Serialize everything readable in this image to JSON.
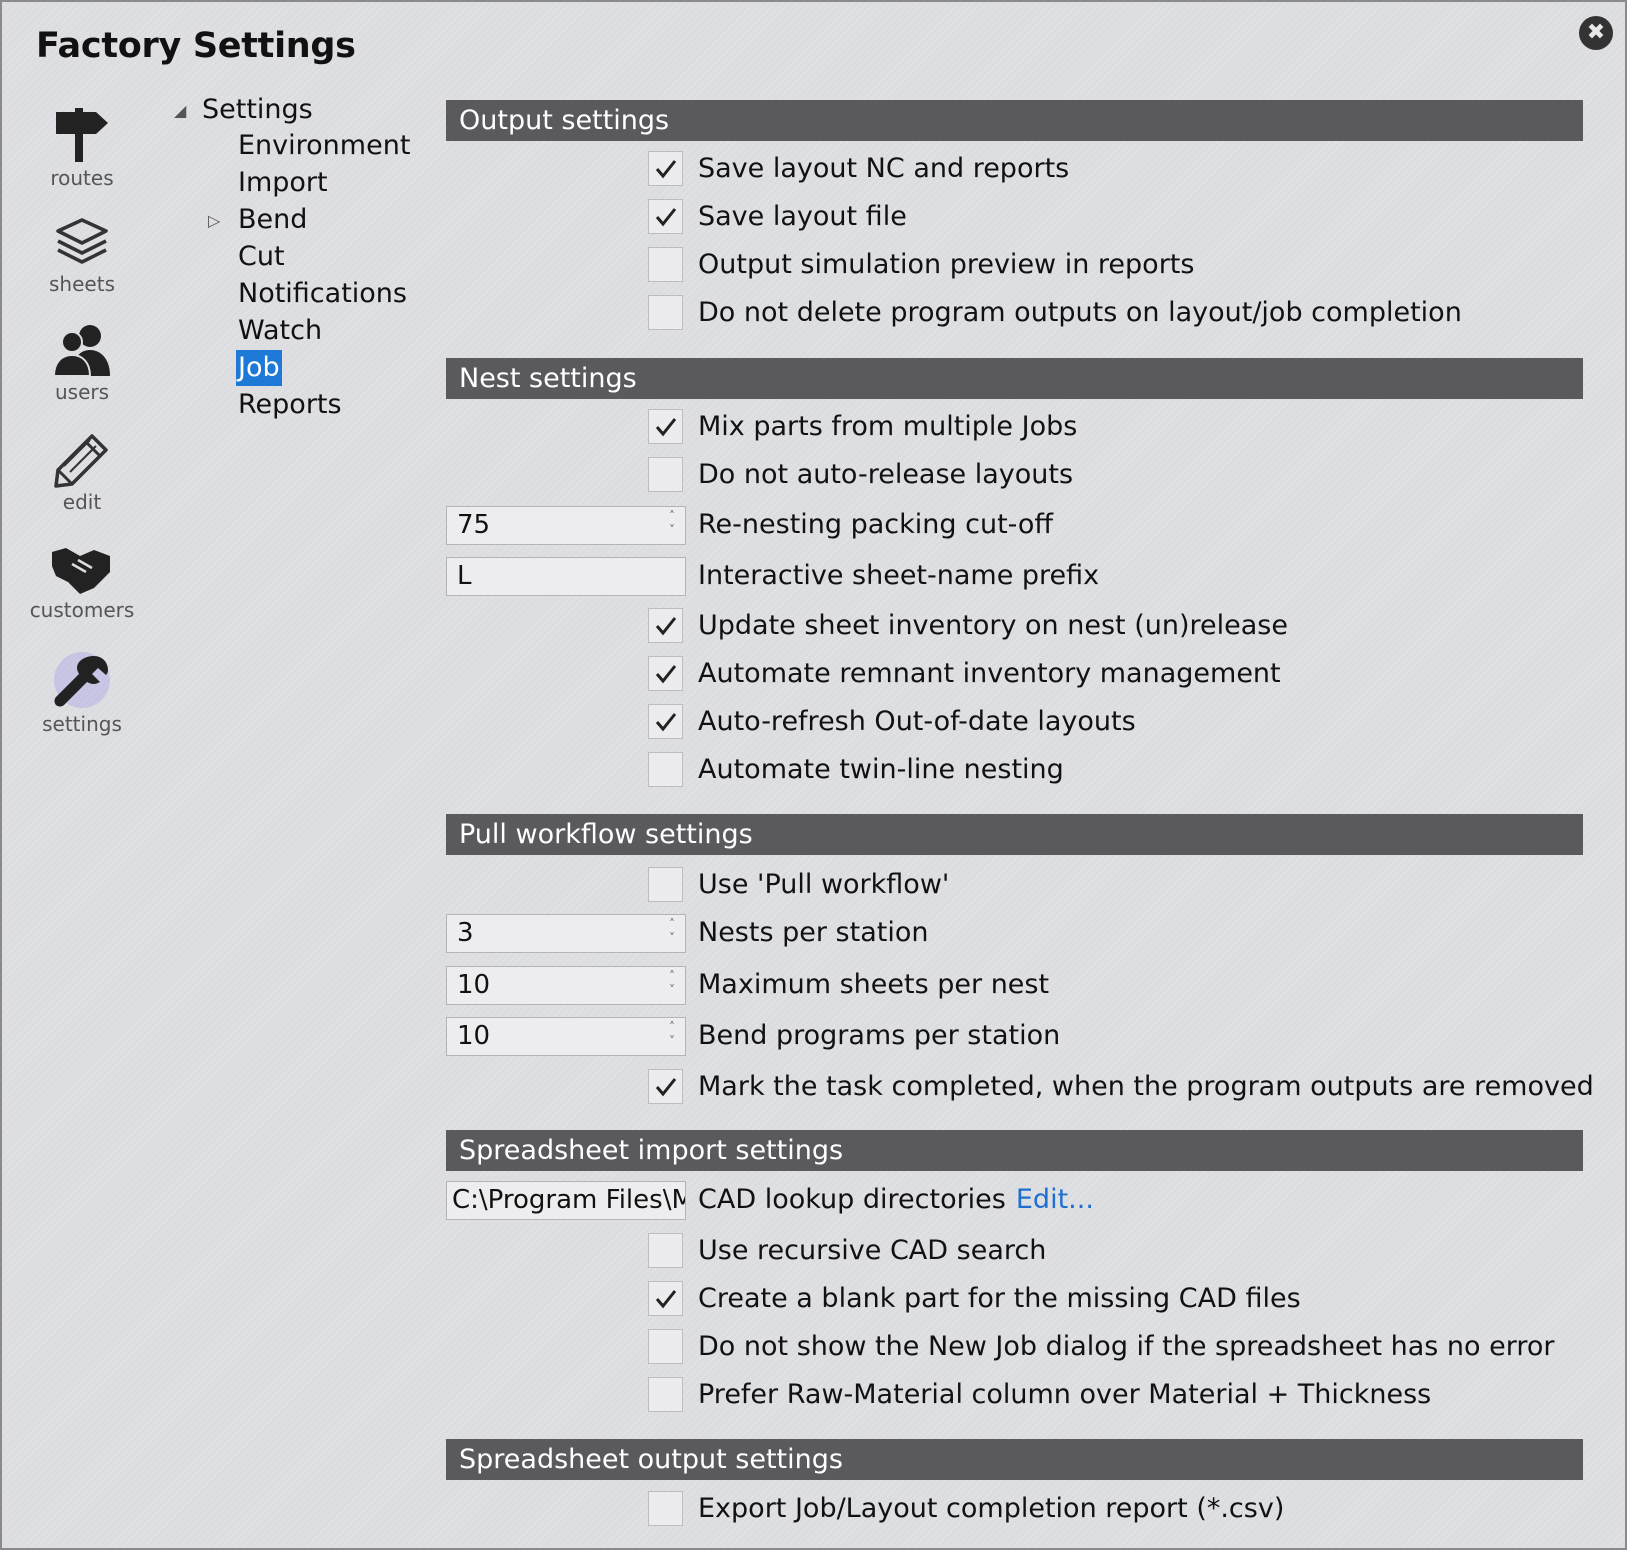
{
  "window": {
    "title": "Factory Settings",
    "close_glyph": "✖"
  },
  "rail": [
    {
      "label": "routes",
      "icon": "signpost-icon"
    },
    {
      "label": "sheets",
      "icon": "layers-icon"
    },
    {
      "label": "users",
      "icon": "users-icon"
    },
    {
      "label": "edit",
      "icon": "pencil-icon"
    },
    {
      "label": "customers",
      "icon": "handshake-icon"
    },
    {
      "label": "settings",
      "icon": "wrench-icon",
      "active": true
    }
  ],
  "tree": {
    "root": "Settings",
    "items": [
      "Environment",
      "Import",
      "Bend",
      "Cut",
      "Notifications",
      "Watch",
      "Job",
      "Reports"
    ],
    "selected": "Job"
  },
  "sections": {
    "output": {
      "title": "Output settings",
      "items": [
        {
          "label": "Save layout NC and reports",
          "checked": true
        },
        {
          "label": "Save layout file",
          "checked": true
        },
        {
          "label": "Output simulation preview in reports",
          "checked": false
        },
        {
          "label": "Do not delete program outputs on layout/job completion",
          "checked": false
        }
      ]
    },
    "nest": {
      "title": "Nest settings",
      "mix_parts": "Mix parts from multiple Jobs",
      "no_auto_release": "Do not auto-release layouts",
      "renest_value": "75",
      "renest_label": "Re-nesting packing cut-off",
      "prefix_value": "L",
      "prefix_label": "Interactive sheet-name prefix",
      "update_inventory": "Update sheet inventory on nest (un)release",
      "automate_remnant": "Automate remnant inventory management",
      "auto_refresh": "Auto-refresh Out-of-date layouts",
      "twin_line": "Automate twin-line nesting"
    },
    "pull": {
      "title": "Pull workflow settings",
      "use_pull": "Use 'Pull workflow'",
      "nests_value": "3",
      "nests_label": "Nests per station",
      "max_sheets_value": "10",
      "max_sheets_label": "Maximum sheets per nest",
      "bend_value": "10",
      "bend_label": "Bend programs per station",
      "mark_completed": "Mark the task completed, when the program outputs are removed"
    },
    "spreadsheet_import": {
      "title": "Spreadsheet import settings",
      "cad_dir_value": "C:\\Program Files\\M",
      "cad_dir_label": "CAD lookup directories",
      "edit_link": "Edit...",
      "recursive": "Use recursive CAD search",
      "blank_part": "Create a blank part for the missing CAD files",
      "no_new_job": "Do not show the New Job dialog if the spreadsheet has no error",
      "prefer_raw": "Prefer Raw-Material column over Material + Thickness"
    },
    "spreadsheet_output": {
      "title": "Spreadsheet output settings",
      "export_report": "Export Job/Layout completion report (*.csv)"
    }
  },
  "colors": {
    "accent": "#1e78d6",
    "header_bg": "#5a5a5e",
    "link": "#1f6fd0"
  }
}
